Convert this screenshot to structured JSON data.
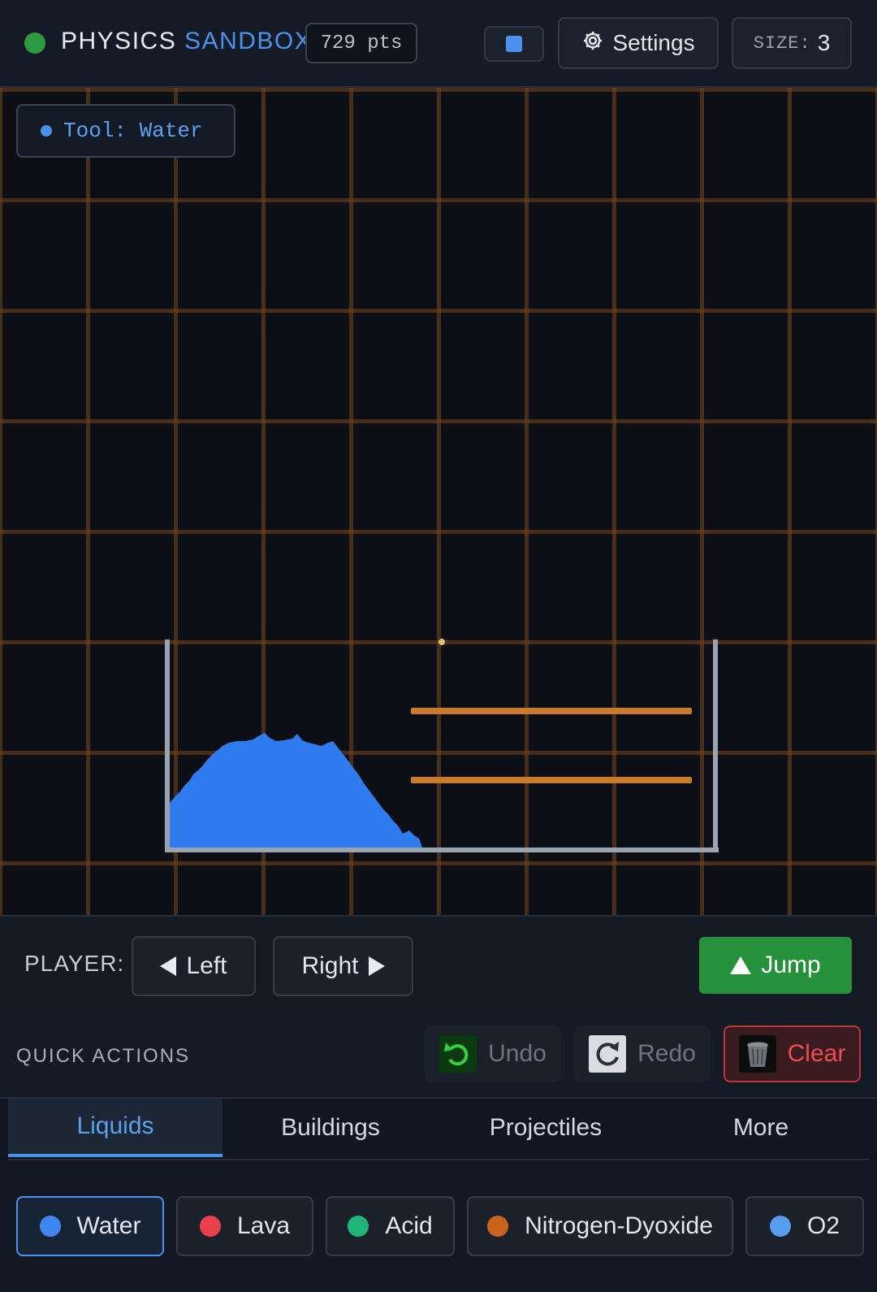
{
  "header": {
    "title_main": "PHYSICS",
    "title_accent": "SANDBOX",
    "points": "729 pts",
    "settings_label": "Settings",
    "size_label": "SIZE:",
    "size_value": "3",
    "status_color": "#2c9a3f",
    "accent_color": "#4c93e8"
  },
  "canvas": {
    "tool_label": "Tool: Water"
  },
  "player": {
    "label": "PLAYER:",
    "left_label": "Left",
    "right_label": "Right",
    "jump_label": "Jump",
    "jump_color": "#25913a"
  },
  "quick_actions": {
    "label": "QUICK ACTIONS",
    "undo_label": "Undo",
    "redo_label": "Redo",
    "clear_label": "Clear",
    "undo_enabled": false,
    "redo_enabled": false
  },
  "tabs": [
    {
      "label": "Liquids",
      "active": true
    },
    {
      "label": "Buildings",
      "active": false
    },
    {
      "label": "Projectiles",
      "active": false
    },
    {
      "label": "More",
      "active": false
    }
  ],
  "materials": [
    {
      "label": "Water",
      "color": "#3f86f0",
      "selected": true
    },
    {
      "label": "Lava",
      "color": "#e8414a",
      "selected": false
    },
    {
      "label": "Acid",
      "color": "#1fb578",
      "selected": false
    },
    {
      "label": "Nitrogen-Dyoxide",
      "color": "#c8621c",
      "selected": false
    },
    {
      "label": "O2",
      "color": "#5a9cf0",
      "selected": false
    }
  ]
}
